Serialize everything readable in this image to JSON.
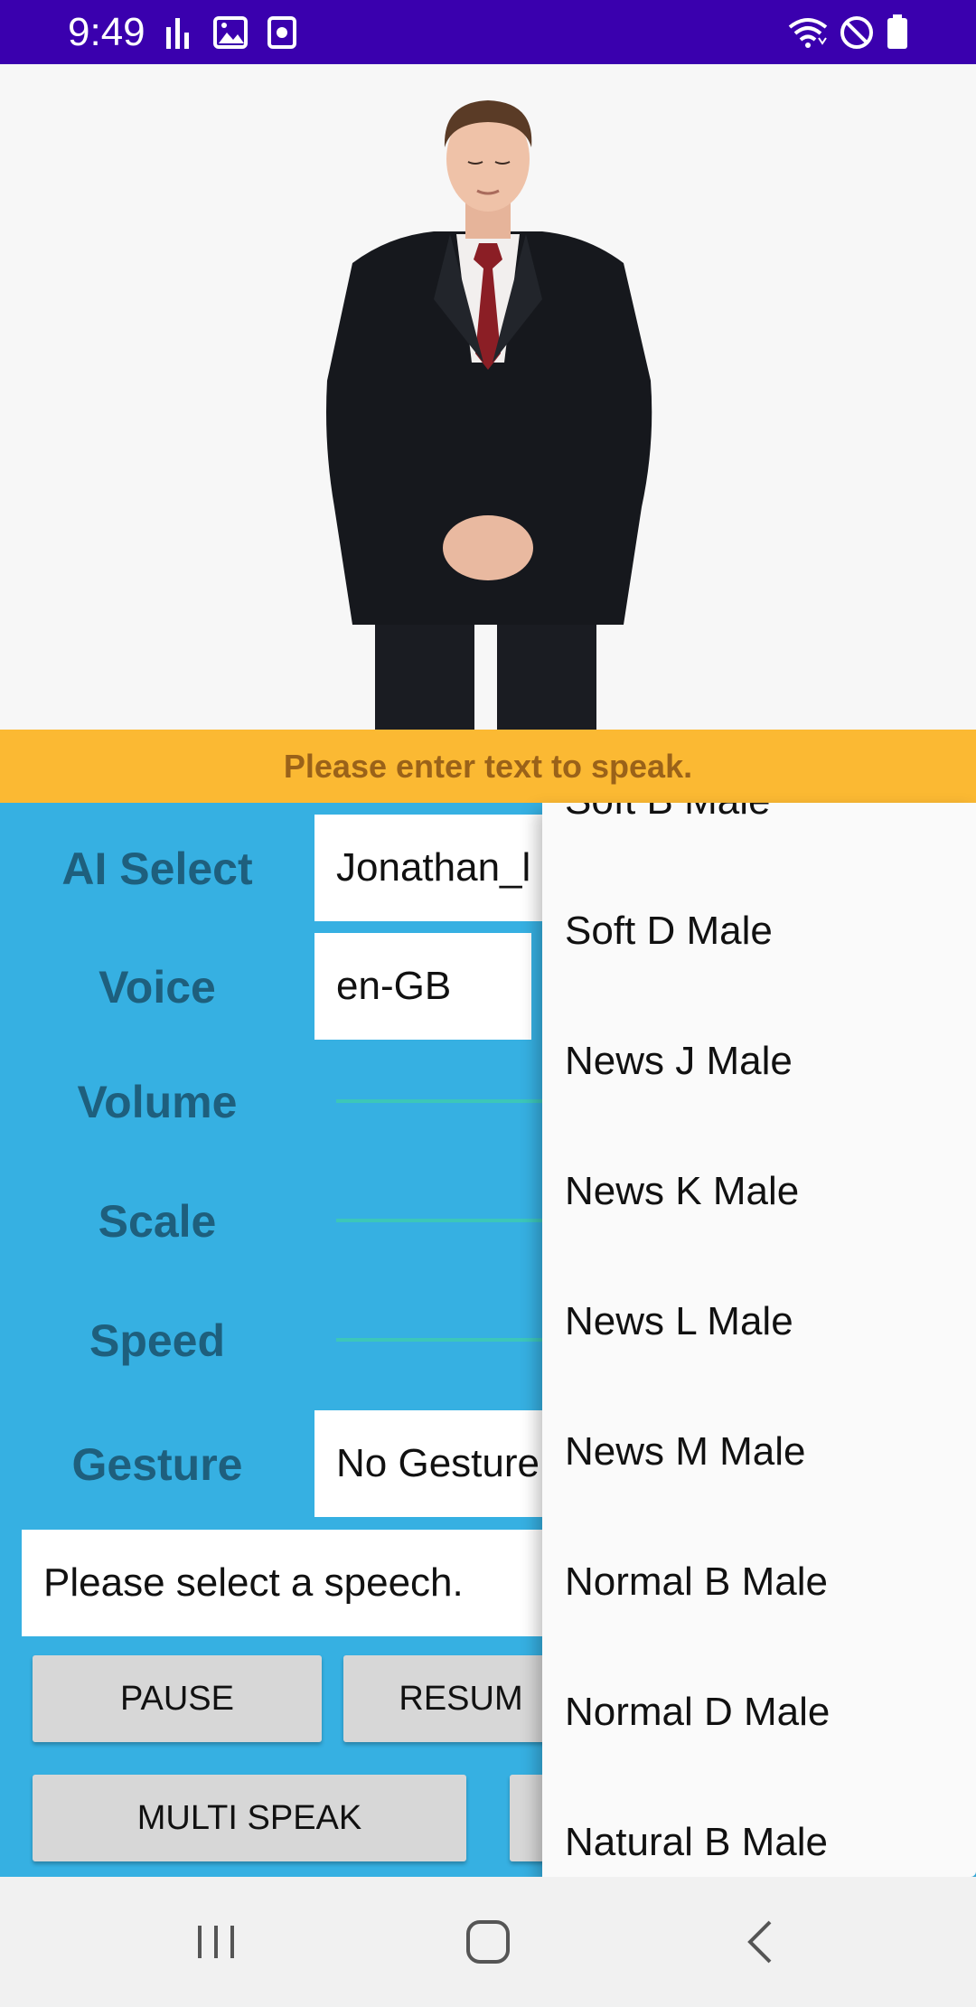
{
  "status_bar": {
    "time": "9:49",
    "left_icons": [
      "signal-bars-icon",
      "image-icon",
      "camera-icon"
    ],
    "right_icons": [
      "wifi-icon",
      "do-not-disturb-icon",
      "battery-icon"
    ]
  },
  "banner": {
    "text": "Please enter text to speak."
  },
  "controls": {
    "ai_select": {
      "label": "AI Select",
      "value": "Jonathan_l"
    },
    "voice": {
      "label": "Voice",
      "value": "en-GB"
    },
    "volume": {
      "label": "Volume"
    },
    "scale": {
      "label": "Scale"
    },
    "speed": {
      "label": "Speed"
    },
    "gesture": {
      "label": "Gesture",
      "value": "No Gesture"
    },
    "speech": {
      "value": "Please select a speech."
    }
  },
  "buttons": {
    "pause": "PAUSE",
    "resume": "RESUM",
    "multi_speak": "MULTI SPEAK"
  },
  "dropdown": {
    "items": [
      "Soft B Male",
      "Soft D Male",
      "News J Male",
      "News K Male",
      "News L Male",
      "News M Male",
      "Normal B Male",
      "Normal D Male",
      "Natural B Male"
    ]
  },
  "nav_bar": {
    "buttons": [
      "recent-apps-icon",
      "home-icon",
      "back-icon"
    ]
  },
  "colors": {
    "status_bar": "#3a00ae",
    "banner": "#fbb933",
    "panel": "#36b0e2",
    "label_text": "#1e5f7d",
    "slider": "#3cc7b9"
  }
}
